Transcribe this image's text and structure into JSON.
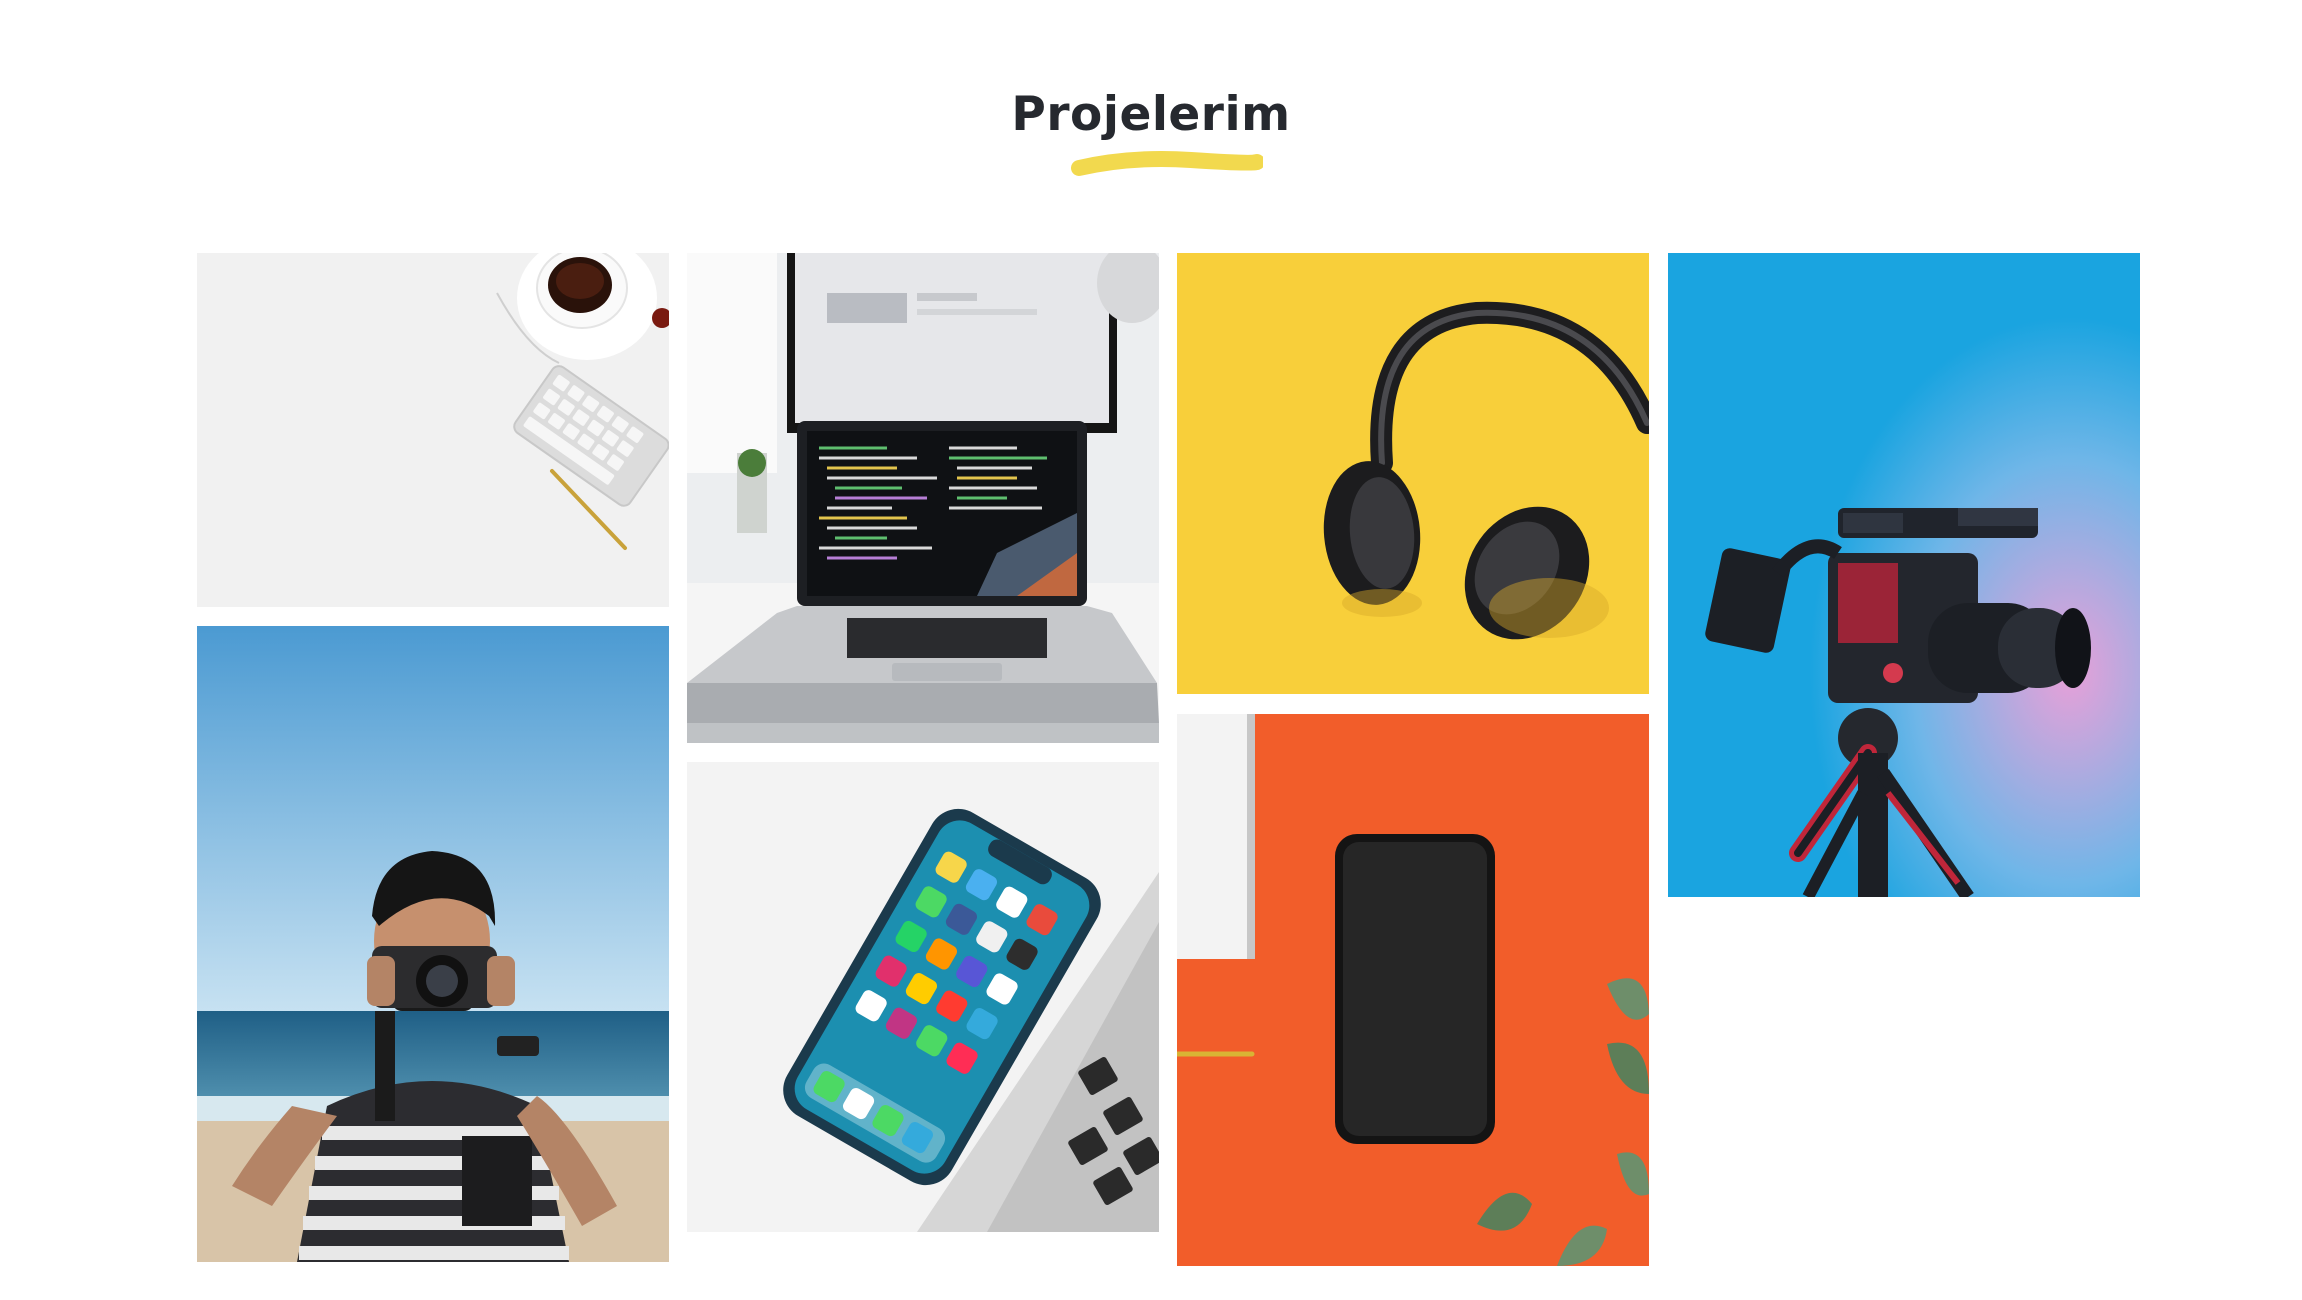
{
  "section": {
    "title": "Projelerim",
    "accent_color": "#f2d94e"
  },
  "gallery": {
    "items": [
      {
        "id": "desk",
        "icon": "desk-keyboard-coffee-image"
      },
      {
        "id": "photographer",
        "icon": "beach-photographer-image"
      },
      {
        "id": "laptop",
        "icon": "laptop-code-image"
      },
      {
        "id": "iphone",
        "icon": "iphone-image"
      },
      {
        "id": "headphones",
        "icon": "headphones-image"
      },
      {
        "id": "phone",
        "icon": "black-phone-image"
      },
      {
        "id": "camera",
        "icon": "video-camera-image"
      }
    ]
  },
  "colors": {
    "title_text": "#26292f",
    "headphones_bg": "#f8cf3a",
    "phone_bg": "#f25d2a",
    "camera_bg": "#1aa4e0"
  }
}
